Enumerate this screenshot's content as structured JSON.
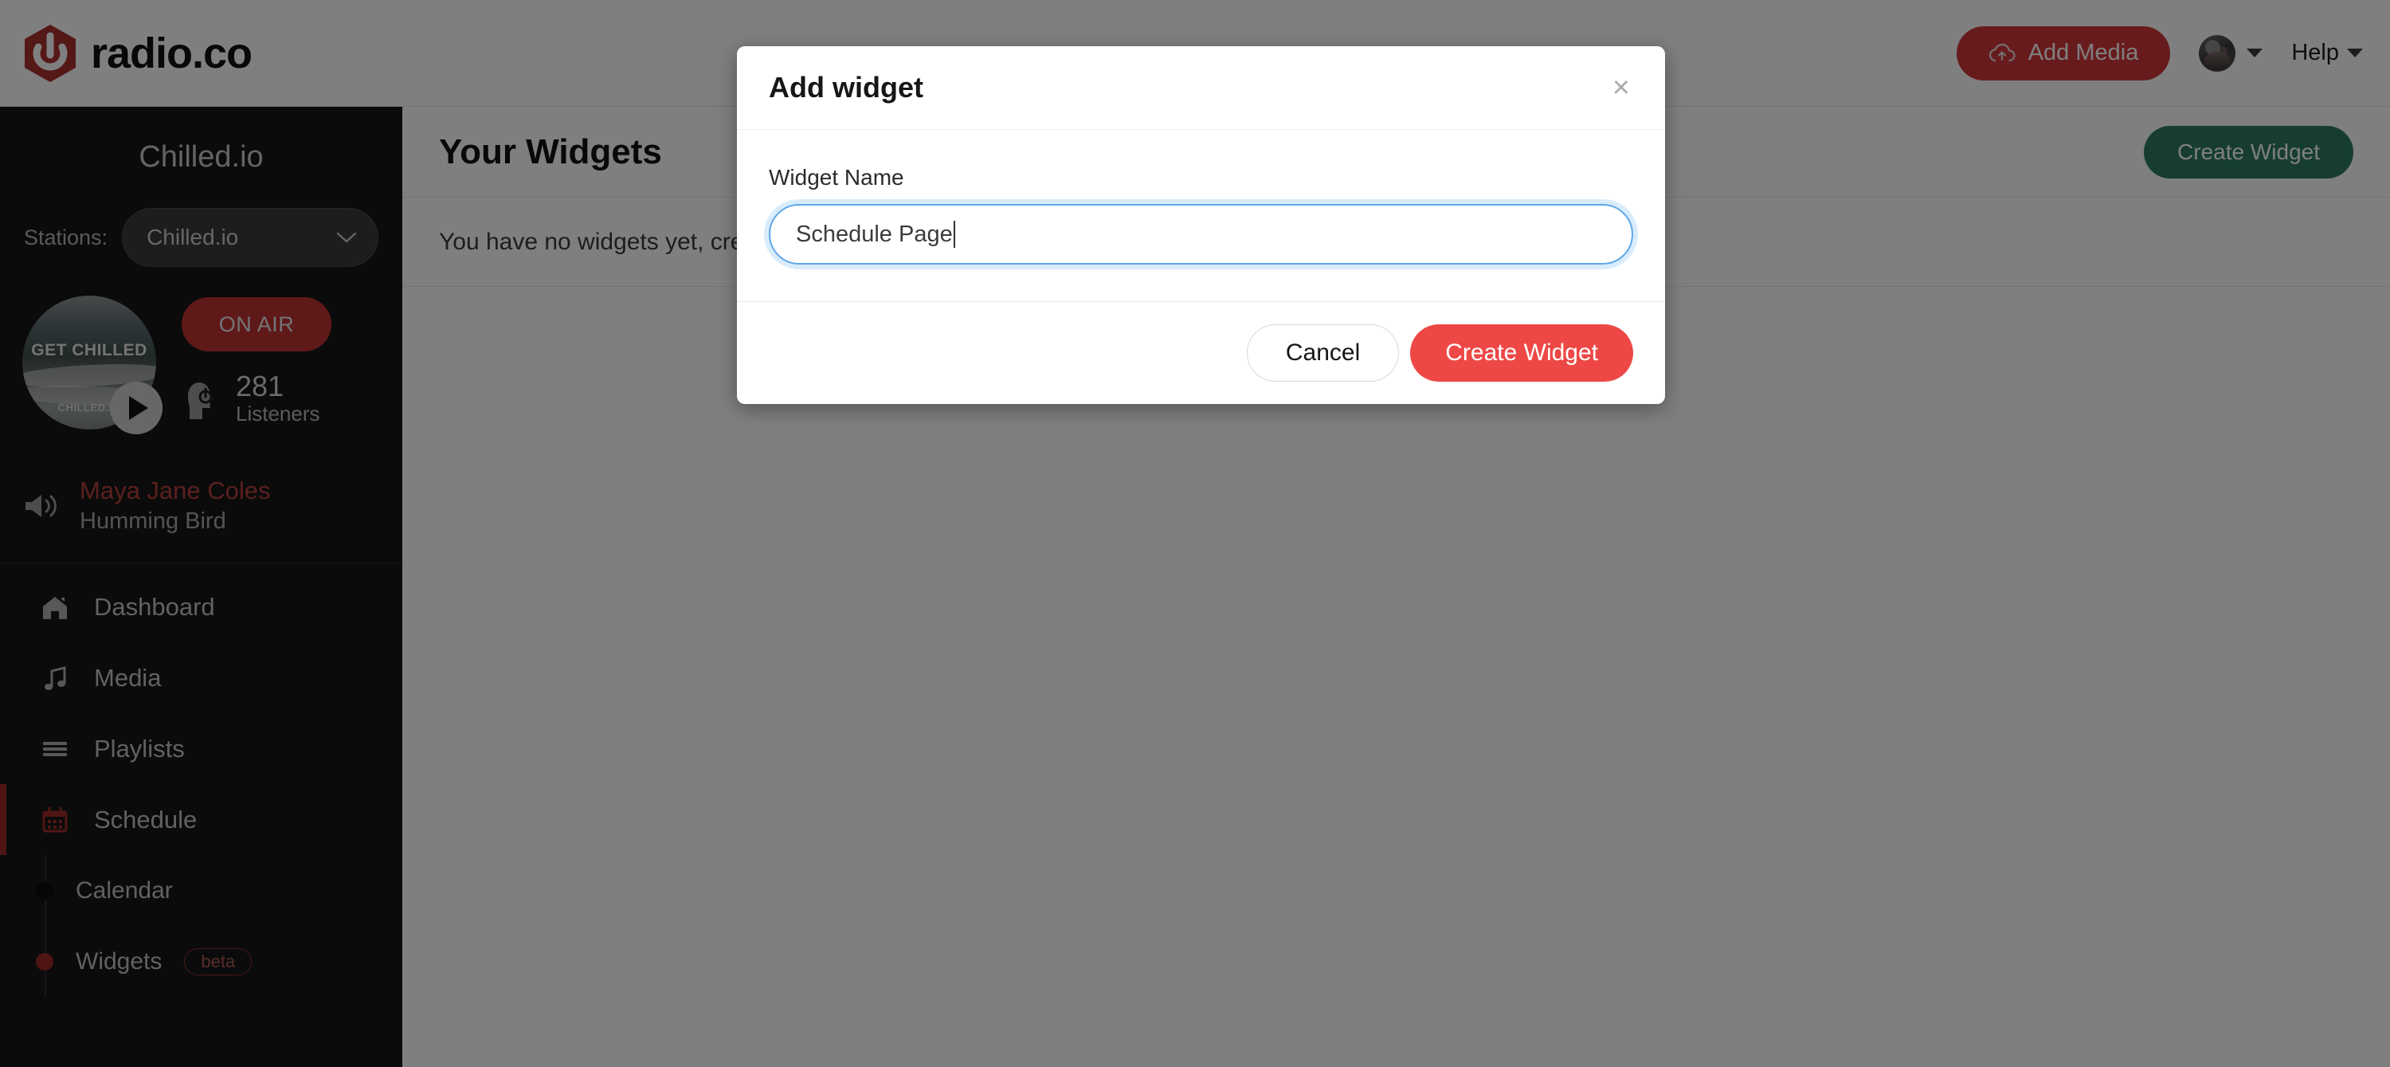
{
  "brand": {
    "name": "radio.co",
    "logo_icon": "power-hexagon-icon",
    "accent": "#b5302f"
  },
  "topbar": {
    "add_media_label": "Add Media",
    "add_media_icon": "cloud-upload-icon",
    "avatar_icon": "user-avatar",
    "avatar_caret_icon": "caret-down-icon",
    "help_label": "Help",
    "help_caret_icon": "caret-down-icon"
  },
  "sidebar": {
    "station_title": "Chilled.io",
    "stations_label": "Stations:",
    "station_selected": "Chilled.io",
    "station_chevron_icon": "chevron-down-icon",
    "artwork": {
      "line1": "GET CHILLED",
      "line2": "CHILLED.IO",
      "play_icon": "play-icon"
    },
    "on_air_label": "ON AIR",
    "listeners_icon": "headphones-listener-icon",
    "listeners_count": "281",
    "listeners_label": "Listeners",
    "now_playing": {
      "speaker_icon": "speaker-icon",
      "artist": "Maya Jane Coles",
      "track": "Humming Bird",
      "artist_color": "#b7403d"
    },
    "nav": [
      {
        "label": "Dashboard",
        "icon": "home-icon",
        "active": false
      },
      {
        "label": "Media",
        "icon": "music-note-icon",
        "active": false
      },
      {
        "label": "Playlists",
        "icon": "list-lines-icon",
        "active": false
      },
      {
        "label": "Schedule",
        "icon": "calendar-icon",
        "active": true
      }
    ],
    "sub_nav": [
      {
        "label": "Calendar",
        "active": false
      },
      {
        "label": "Widgets",
        "active": true,
        "badge": "beta"
      }
    ]
  },
  "main": {
    "page_title": "Your Widgets",
    "create_widget_label": "Create Widget",
    "create_widget_color": "#2f7a63",
    "empty_message": "You have no widgets yet, create one to get started."
  },
  "modal": {
    "title": "Add widget",
    "close_icon": "close-icon",
    "field_label": "Widget Name",
    "field_value": "Schedule Page",
    "field_placeholder": "Widget Name",
    "cancel_label": "Cancel",
    "submit_label": "Create Widget",
    "submit_color": "#ee4846",
    "focus_ring_color": "#5ea8ea"
  }
}
